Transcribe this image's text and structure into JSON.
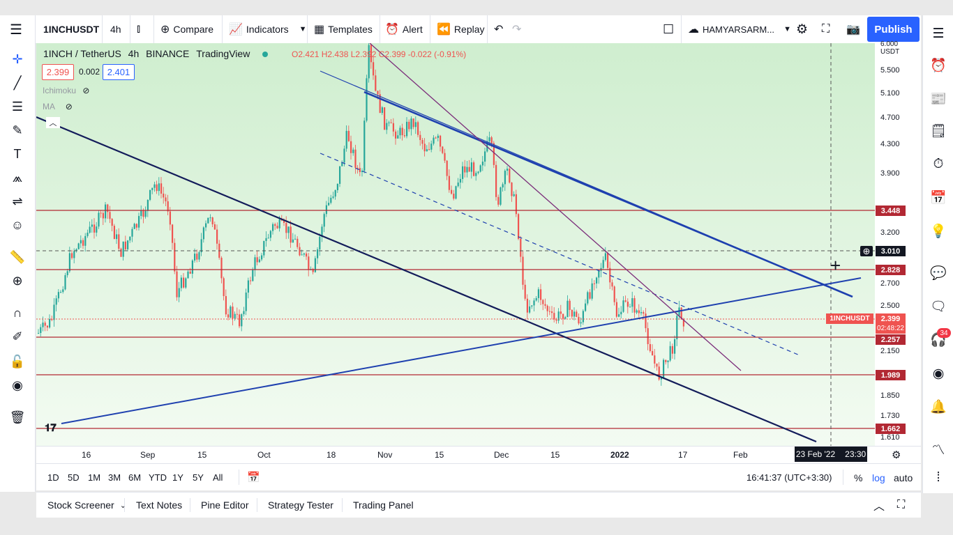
{
  "toolbar": {
    "symbol": "1INCHUSDT",
    "interval": "4h",
    "compare_label": "Compare",
    "indicators_label": "Indicators",
    "templates_label": "Templates",
    "alert_label": "Alert",
    "replay_label": "Replay",
    "layout_name": "HAMYARSARM...",
    "publish_label": "Publish"
  },
  "legend": {
    "pair": "1INCH / TetherUS",
    "interval": "4h",
    "exchange": "BINANCE",
    "source": "TradingView",
    "ohlc": "O2.421  H2.438  L2.392  C2.399  -0.022  (-0.91%)",
    "bid": "2.399",
    "spread": "0.002",
    "ask": "2.401",
    "indicator1": "Ichimoku",
    "indicator2": "MA"
  },
  "price_axis": {
    "unit_top": "6.000",
    "unit": "USDT",
    "ticks": [
      "5.500",
      "5.100",
      "4.700",
      "4.300",
      "3.900",
      "3.200",
      "2.700",
      "2.500",
      "2.150",
      "1.850",
      "1.730",
      "1.610"
    ],
    "label_3448": "3.448",
    "label_3010": "3.010",
    "label_2828": "2.828",
    "label_2399": "2.399",
    "label_2257": "2.257",
    "label_1989": "1.989",
    "label_1662": "1.662",
    "symbol_tag": "1INCHUSDT",
    "countdown": "02:48:22"
  },
  "time_axis": {
    "ticks": [
      "16",
      "Sep",
      "15",
      "Oct",
      "18",
      "Nov",
      "15",
      "Dec",
      "15",
      "2022",
      "17",
      "Feb"
    ],
    "cross_date": "23 Feb '22",
    "cross_time": "23:30"
  },
  "range": {
    "buttons": [
      "1D",
      "5D",
      "1M",
      "3M",
      "6M",
      "YTD",
      "1Y",
      "5Y",
      "All"
    ],
    "clock": "16:41:37 (UTC+3:30)",
    "percent": "%",
    "log": "log",
    "auto": "auto"
  },
  "bottom": {
    "tabs": [
      "Stock Screener",
      "Text Notes",
      "Pine Editor",
      "Strategy Tester",
      "Trading Panel"
    ]
  },
  "alerts_count": "34",
  "colors": {
    "accent": "#2962ff",
    "bull": "#26a69a",
    "bear": "#ef5350",
    "level": "#b22833",
    "trend_blue": "#1e40af",
    "trend_navy": "#131c5a",
    "trend_purple": "#7b2d7a"
  }
}
